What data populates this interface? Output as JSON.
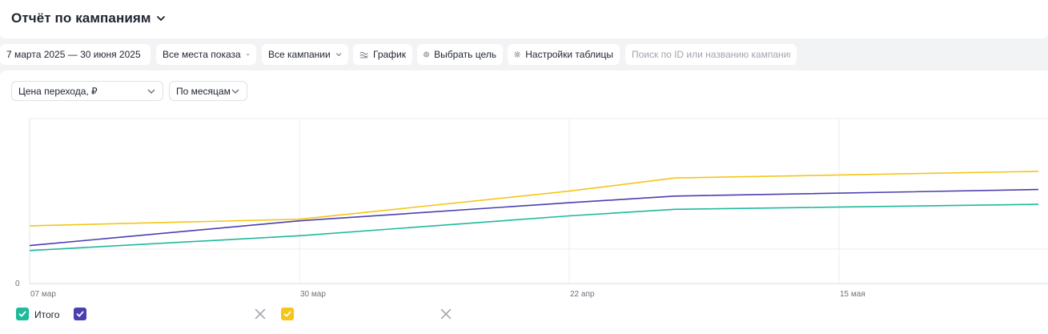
{
  "header": {
    "title": "Отчёт по кампаниям"
  },
  "filters": {
    "date_range": "7 марта 2025 — 30 июня 2025",
    "placements": "Все места показа",
    "campaigns": "Все кампании",
    "chart_button": "График",
    "goal_button": "Выбрать цель",
    "table_settings": "Настройки таблицы",
    "search_placeholder": "Поиск по ID или названию кампании"
  },
  "controls": {
    "metric": "Цена перехода, ₽",
    "grouping": "По месяцам"
  },
  "colors": {
    "teal": "#1fb99c",
    "purple": "#4b3fb0",
    "yellow": "#f5c518",
    "grid": "#ececee"
  },
  "legend": {
    "items": [
      {
        "label": "Итого",
        "color": "#1fb99c",
        "checked": true
      },
      {
        "label": "",
        "color": "#4b3fb0",
        "checked": true,
        "removable": true
      },
      {
        "label": "",
        "color": "#f5c518",
        "checked": true,
        "removable": true
      }
    ]
  },
  "chart_data": {
    "type": "line",
    "x_ticks": [
      "07 мар",
      "30 мар",
      "22 апр",
      "15 мая"
    ],
    "y_ticks": [
      "0"
    ],
    "grid": true,
    "legend_position": "bottom-left",
    "x": [
      "2025-03-07",
      "2025-03-30",
      "2025-04-22",
      "2025-05-01",
      "2025-06-30"
    ],
    "ylim": [
      0,
      100
    ],
    "series": [
      {
        "name": "Итого",
        "color": "#1fb99c",
        "values": [
          20,
          29,
          41,
          45,
          48
        ]
      },
      {
        "color": "#4b3fb0",
        "values": [
          23,
          38,
          49,
          53,
          57
        ]
      },
      {
        "color": "#f5c518",
        "values": [
          35,
          39,
          56,
          64,
          68
        ]
      }
    ]
  }
}
